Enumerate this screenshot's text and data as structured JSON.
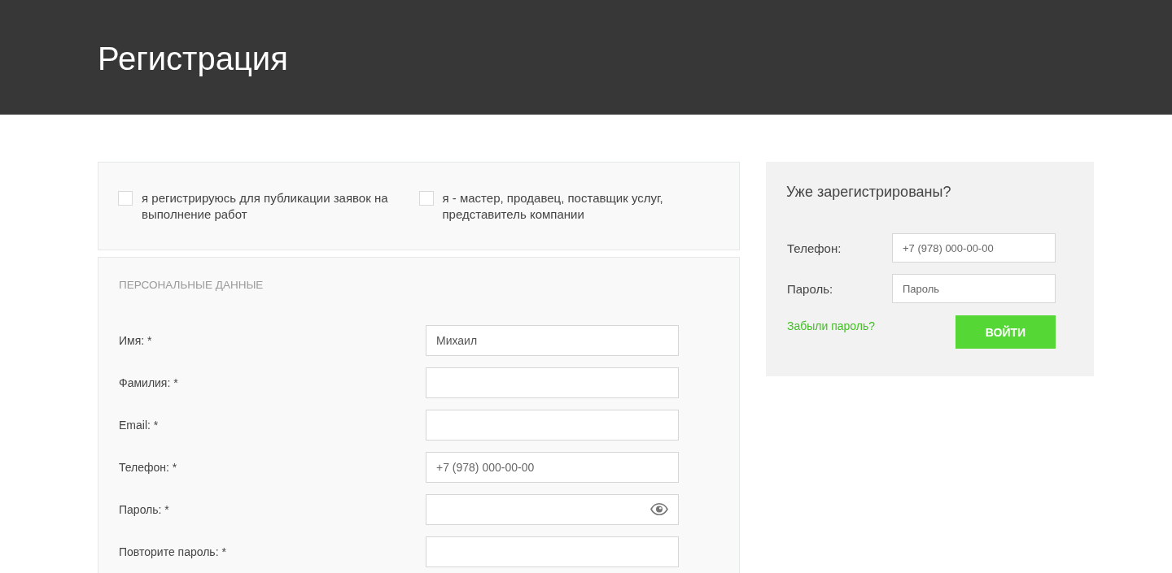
{
  "header": {
    "title": "Регистрация"
  },
  "roles": [
    {
      "label": "я регистрируюсь для публикации заявок на выполнение работ",
      "checked": false
    },
    {
      "label": "я - мастер, продавец, поставщик услуг, представитель компании",
      "checked": false
    }
  ],
  "personal": {
    "heading": "ПЕРСОНАЛЬНЫЕ ДАННЫЕ",
    "fields": [
      {
        "label": "Имя: *",
        "kind": "text",
        "value": "Михаил"
      },
      {
        "label": "Фамилия: *",
        "kind": "text"
      },
      {
        "label": "Email: *",
        "kind": "text"
      },
      {
        "label": "Телефон: *",
        "kind": "text",
        "placeholder": "+7 (978) 000-00-00"
      },
      {
        "label": "Пароль: *",
        "kind": "password"
      },
      {
        "label": "Повторите пароль: *",
        "kind": "text"
      }
    ]
  },
  "login": {
    "title": "Уже зарегистрированы?",
    "fields": [
      {
        "label": "Телефон:",
        "placeholder": "+7 (978) 000-00-00"
      },
      {
        "label": "Пароль:",
        "placeholder": "Пароль"
      }
    ],
    "forgot_link": "Забыли пароль?",
    "submit": "ВОЙТИ"
  }
}
